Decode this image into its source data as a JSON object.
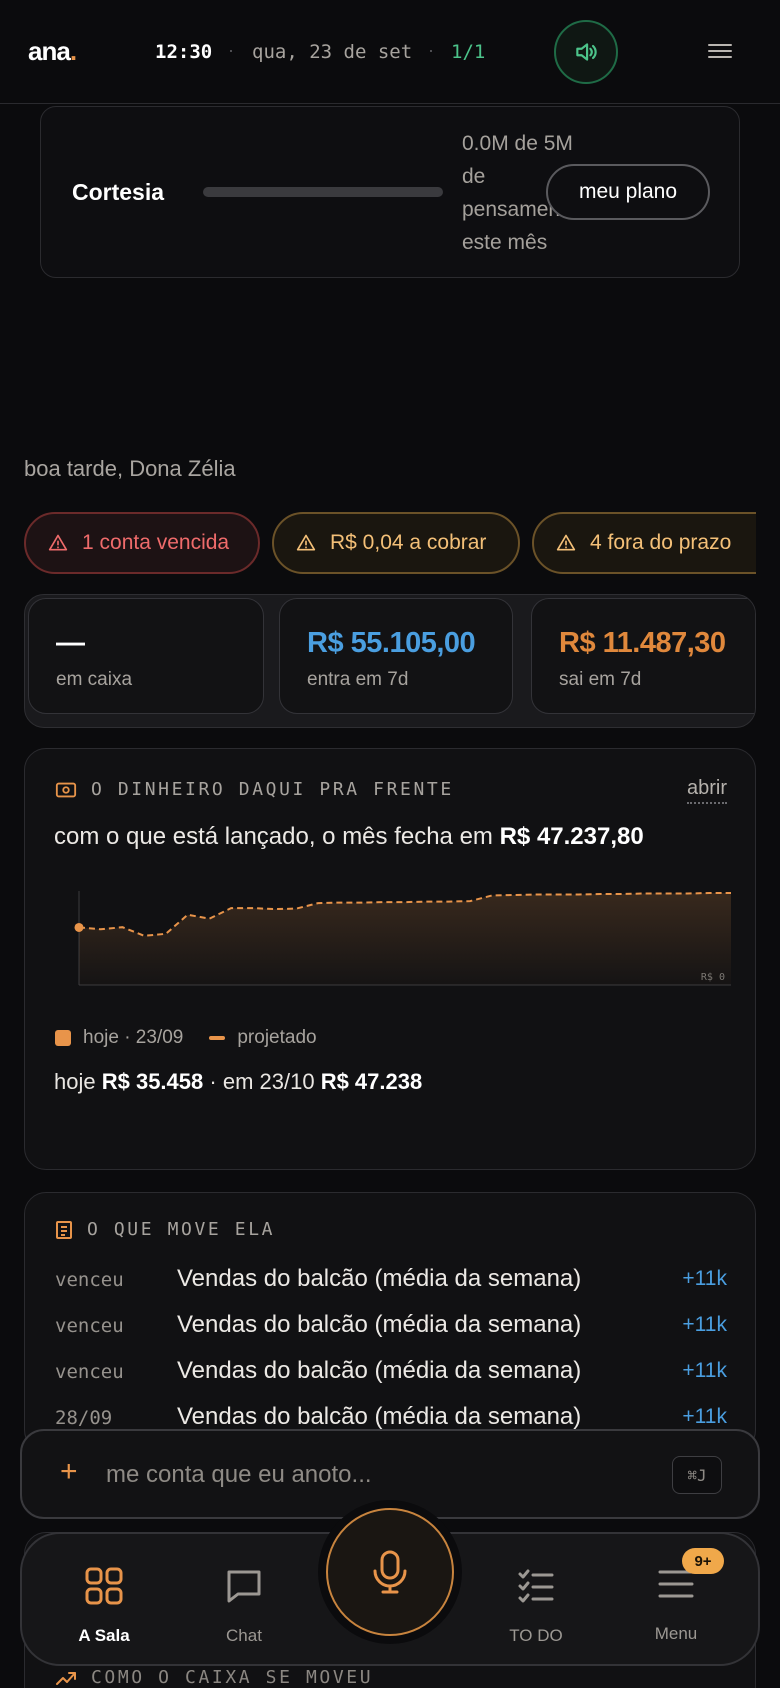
{
  "header": {
    "logo_text": "ana",
    "logo_dot": ".",
    "time": "12:30",
    "date": "qua, 23 de set",
    "separator": "·",
    "counter": "1/1",
    "sound_icon": "speaker-icon",
    "menu_icon": "hamburger-icon"
  },
  "plan": {
    "name": "Cortesia",
    "usage_text": "0.0M de 5M de pensamento este mês",
    "usage_fraction": 0,
    "button_label": "meu plano"
  },
  "greeting": "boa tarde, Dona Zélia",
  "alerts": [
    {
      "label": "1 conta vencida",
      "tone": "red",
      "icon": "warning-icon"
    },
    {
      "label": "R$ 0,04 a cobrar",
      "tone": "amber",
      "icon": "warning-icon"
    },
    {
      "label": "4 fora do prazo",
      "tone": "amber",
      "icon": "warning-icon"
    }
  ],
  "kpis": [
    {
      "value": "—",
      "label": "em caixa",
      "color": "#ffffff"
    },
    {
      "value": "R$ 55.105,00",
      "label": "entra em 7d",
      "color": "#4a9ee0"
    },
    {
      "value": "R$ 11.487,30",
      "label": "sai em 7d",
      "color": "#e0883c"
    }
  ],
  "forecast": {
    "icon": "cash-icon",
    "heading": "O DINHEIRO DAQUI PRA FRENTE",
    "open_label": "abrir",
    "sentence_prefix": "com o que está lançado, o mês fecha em",
    "sentence_value": "R$ 47.237,80",
    "legend_today": "hoje · 23/09",
    "legend_projected": "projetado",
    "summary_today_label": "hoje",
    "summary_today_value": "R$ 35.458",
    "summary_sep": "·",
    "summary_future_label": "em 23/10",
    "summary_future_value": "R$ 47.238"
  },
  "chart_data": {
    "type": "area",
    "series": [
      {
        "name": "projetado",
        "values": [
          35458,
          35100,
          35500,
          33800,
          34200,
          38000,
          37200,
          39300,
          39300,
          39100,
          39200,
          40300,
          40400,
          40400,
          40500,
          40500,
          40600,
          40600,
          40700,
          41800,
          41900,
          42000,
          42000,
          42000,
          42100,
          42100,
          42200,
          42200,
          42200,
          42300,
          42300
        ]
      }
    ],
    "x_start_label": "hoje · 23/09",
    "x_end_label": "em 23/10",
    "baseline_label": "R$ 0",
    "start_value": 35458,
    "end_value": 47238,
    "color": "#e8944a",
    "grid": false
  },
  "movers": {
    "icon": "receipt-icon",
    "heading": "O QUE MOVE ELA",
    "rows": [
      {
        "when": "venceu",
        "desc": "Vendas do balcão (média da semana)",
        "amount": "+11k"
      },
      {
        "when": "venceu",
        "desc": "Vendas do balcão (média da semana)",
        "amount": "+11k"
      },
      {
        "when": "venceu",
        "desc": "Vendas do balcão (média da semana)",
        "amount": "+11k"
      },
      {
        "when": "28/09",
        "desc": "Vendas do balcão (média da semana)",
        "amount": "+11k"
      }
    ]
  },
  "composer": {
    "plus": "+",
    "placeholder": "me conta que eu anoto...",
    "shortcut": "⌘J"
  },
  "next_section": {
    "icon": "trend-up-icon",
    "heading": "COMO O CAIXA SE MOVEU"
  },
  "nav": {
    "items": [
      {
        "label": "A Sala",
        "icon": "grid-icon",
        "active": true
      },
      {
        "label": "Chat",
        "icon": "chat-bubble-icon",
        "active": false
      },
      {
        "label": "TO DO",
        "icon": "checklist-icon",
        "active": false
      },
      {
        "label": "Menu",
        "icon": "menu-lines-icon",
        "active": false
      }
    ],
    "badge": "9+",
    "mic_icon": "microphone-icon"
  }
}
